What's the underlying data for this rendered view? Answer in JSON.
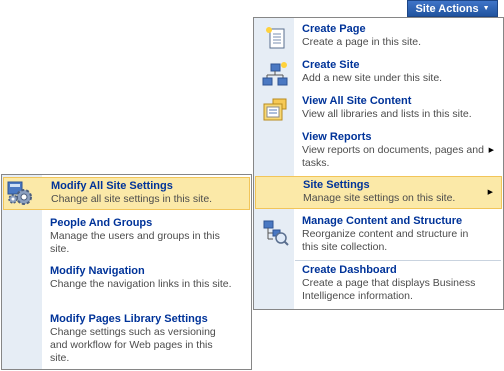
{
  "site_actions_label": "Site Actions",
  "main_menu": {
    "items": [
      {
        "title": "Create Page",
        "desc": "Create a page in this site.",
        "icon": "create-page-icon"
      },
      {
        "title": "Create Site",
        "desc": "Add a new site under this site.",
        "icon": "create-site-icon"
      },
      {
        "title": "View All Site Content",
        "desc": "View all libraries and lists in this site.",
        "icon": "site-content-icon"
      },
      {
        "title": "View Reports",
        "desc": "View reports on documents, pages and tasks.",
        "icon": "",
        "submenu": true
      },
      {
        "title": "Site Settings",
        "desc": "Manage site settings on this site.",
        "icon": "",
        "submenu": true,
        "highlighted": true
      },
      {
        "title": "Manage Content and Structure",
        "desc": "Reorganize content and structure in this site collection.",
        "icon": "manage-content-icon"
      },
      {
        "title": "Create Dashboard",
        "desc": "Create a page that displays Business Intelligence information.",
        "icon": ""
      }
    ]
  },
  "sub_menu": {
    "items": [
      {
        "title": "Modify All Site Settings",
        "desc": "Change all site settings in this site.",
        "icon": "settings-gear-icon",
        "highlighted": true
      },
      {
        "title": "People And Groups",
        "desc": "Manage the users and groups in this site."
      },
      {
        "title": "Modify Navigation",
        "desc": "Change the navigation links in this site."
      },
      {
        "title": "Modify Pages Library Settings",
        "desc": "Change settings such as versioning and workflow for Web pages in this site."
      }
    ]
  },
  "colors": {
    "title": "#003399",
    "highlight": "#fbe9a8",
    "gutter": "#e6edf5",
    "button": "#2a5cab"
  }
}
